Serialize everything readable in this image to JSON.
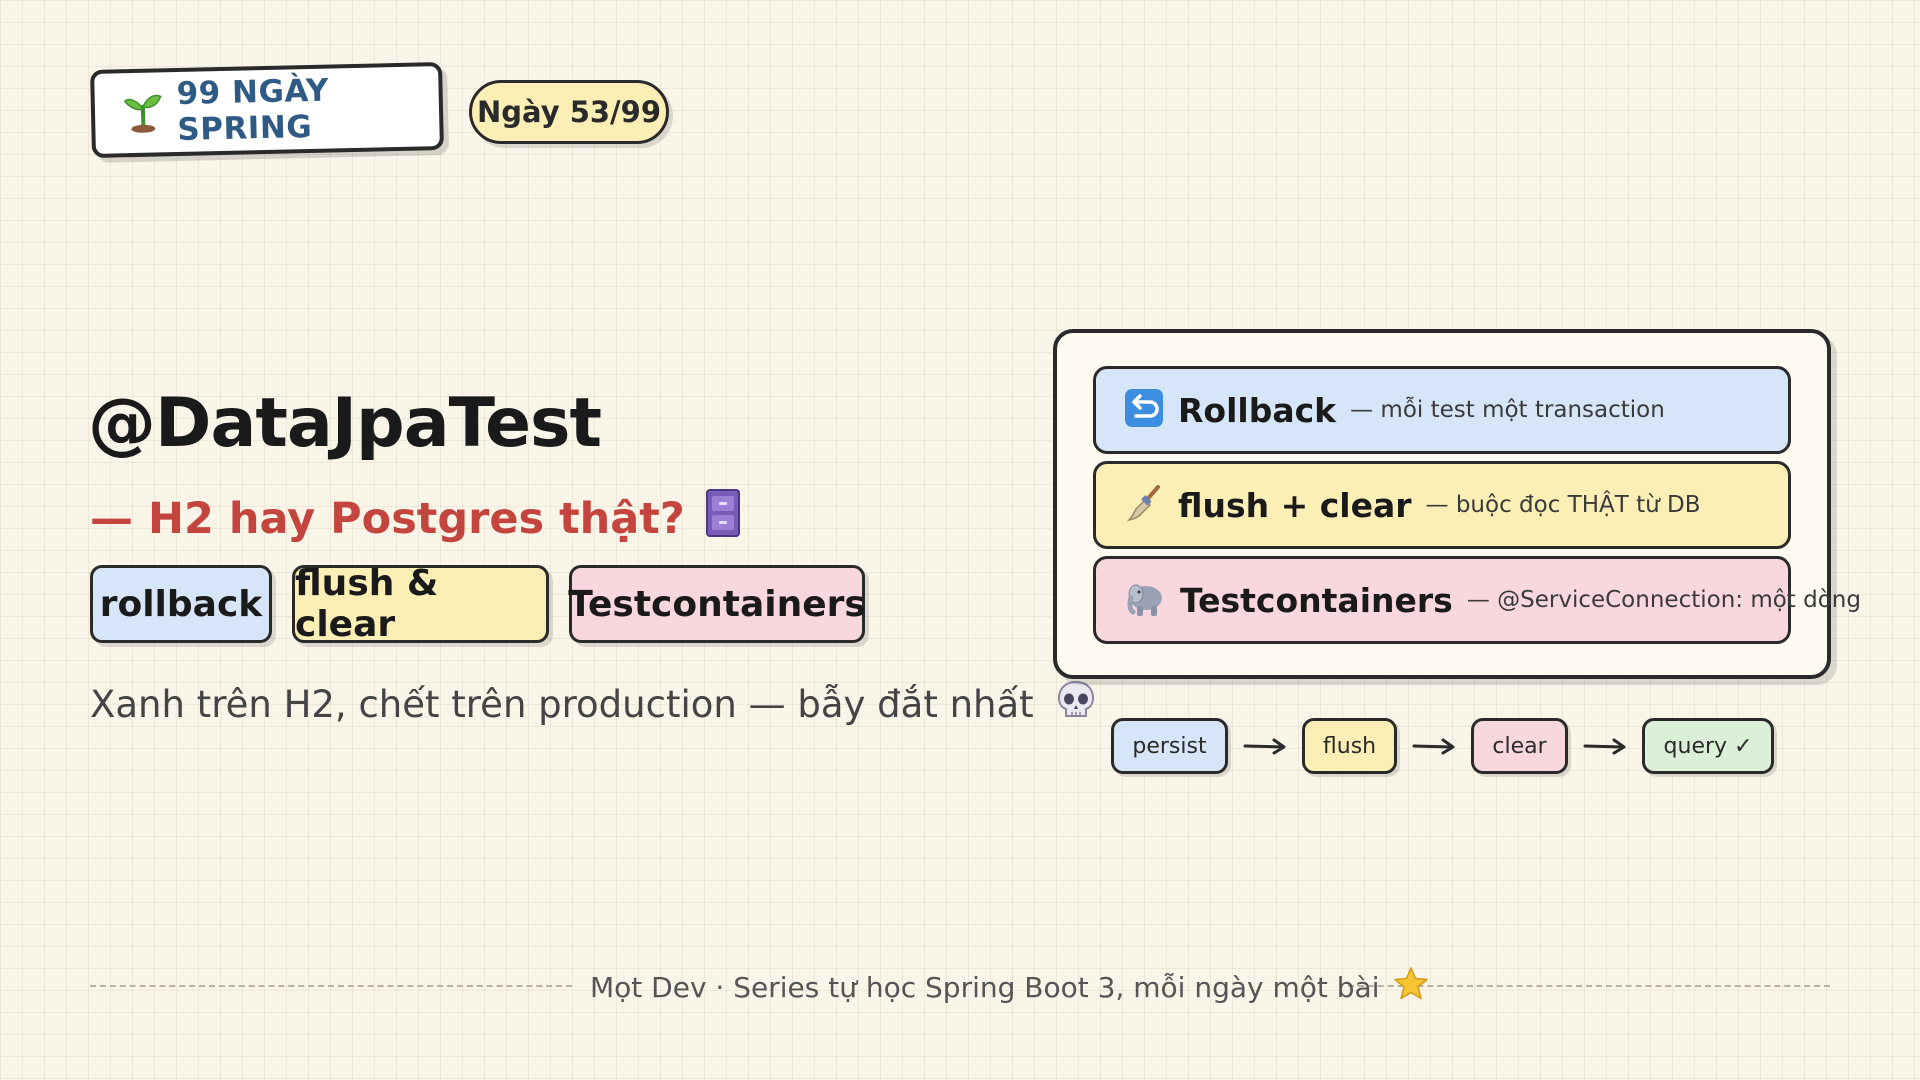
{
  "header": {
    "series_title": "99 NGÀY SPRING",
    "series_icon": "seedling-icon",
    "day_label": "Ngày 53/99"
  },
  "hero": {
    "title": "@DataJpaTest",
    "subtitle": "— H2 hay Postgres thật?",
    "subtitle_icon": "file-cabinet-icon",
    "tags": [
      "rollback",
      "flush & clear",
      "Testcontainers"
    ],
    "tagline": "Xanh trên H2, chết trên production — bẫy đắt nhất",
    "tagline_icon": "skull-icon"
  },
  "panel": {
    "rows": [
      {
        "name": "Rollback",
        "desc": "— mỗi test một transaction",
        "icon": "undo-arrow-icon",
        "color": "#d6e6f8"
      },
      {
        "name": "flush + clear",
        "desc": "— buộc đọc THẬT từ DB",
        "icon": "broom-icon",
        "color": "#fbefb6"
      },
      {
        "name": "Testcontainers",
        "desc": "— @ServiceConnection: một dòng",
        "icon": "elephant-icon",
        "color": "#f9d7df"
      }
    ]
  },
  "flow": {
    "steps": [
      "persist",
      "flush",
      "clear",
      "query ✓"
    ],
    "arrow": "→"
  },
  "footer": {
    "text": "Mọt Dev · Series tự học Spring Boot 3, mỗi ngày một bài",
    "icon": "star-icon"
  },
  "colors": {
    "background": "#faf5e9",
    "accent_red": "#c4453e",
    "title_blue": "#2f5a86",
    "blue": "#d6e6f8",
    "yellow": "#fbefb6",
    "pink": "#f9d7df",
    "green": "#dcefd8"
  }
}
